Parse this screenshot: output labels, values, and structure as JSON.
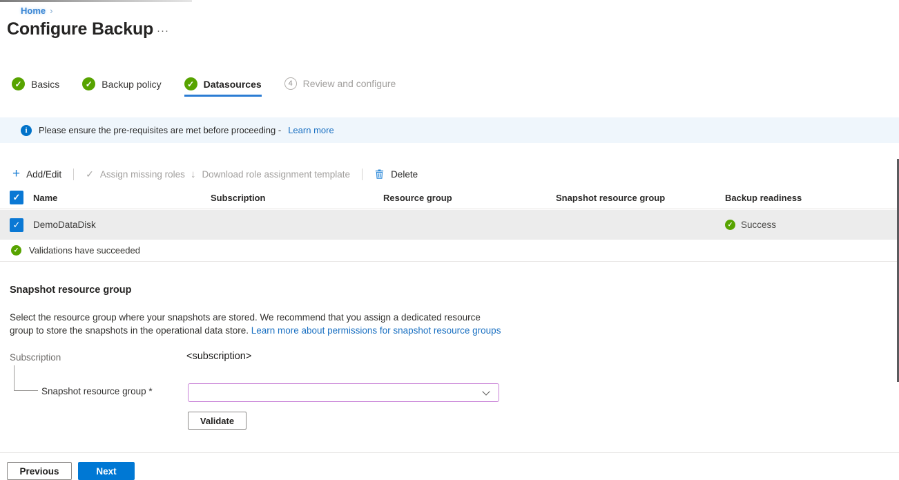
{
  "breadcrumb": {
    "home": "Home",
    "separator": "›"
  },
  "header": {
    "title": "Configure Backup",
    "more_label": "···"
  },
  "steps": [
    {
      "label": "Basics",
      "status": "complete"
    },
    {
      "label": "Backup policy",
      "status": "complete"
    },
    {
      "label": "Datasources",
      "status": "complete",
      "active": true
    },
    {
      "label": "Review and configure",
      "status": "pending",
      "number": "4"
    }
  ],
  "banner": {
    "message": "Please ensure the pre-requisites are met before proceeding -",
    "link_label": "Learn more"
  },
  "toolbar": {
    "add_edit": "Add/Edit",
    "assign_roles": "Assign missing roles",
    "download_template": "Download role assignment template",
    "delete": "Delete"
  },
  "table": {
    "headers": [
      "Name",
      "Subscription",
      "Resource group",
      "Snapshot resource group",
      "Backup readiness"
    ],
    "row": {
      "name": "DemoDataDisk",
      "subscription": "",
      "resource_group": "",
      "snapshot_resource_group": "",
      "backup_readiness": "Success",
      "selected": true
    },
    "validation_message": "Validations have succeeded"
  },
  "section": {
    "title": "Snapshot resource group",
    "description": "Select the resource group where your snapshots are stored. We recommend that you assign a dedicated resource group to store the snapshots in the operational data store.",
    "link_label": "Learn more about permissions for snapshot resource groups"
  },
  "form": {
    "subscription_label": "Subscription",
    "subscription_value": "<subscription>",
    "snapshot_rg_label": "Snapshot resource group *",
    "snapshot_rg_value": "",
    "validate_label": "Validate"
  },
  "footer": {
    "previous_label": "Previous",
    "next_label": "Next"
  },
  "colors": {
    "accent": "#0078d4",
    "success_green": "#57a300",
    "banner_bg": "#eff6fc",
    "focus_border": "#c77fd6",
    "selected_row_bg": "#ececec",
    "disabled_text": "#a19f9d"
  }
}
